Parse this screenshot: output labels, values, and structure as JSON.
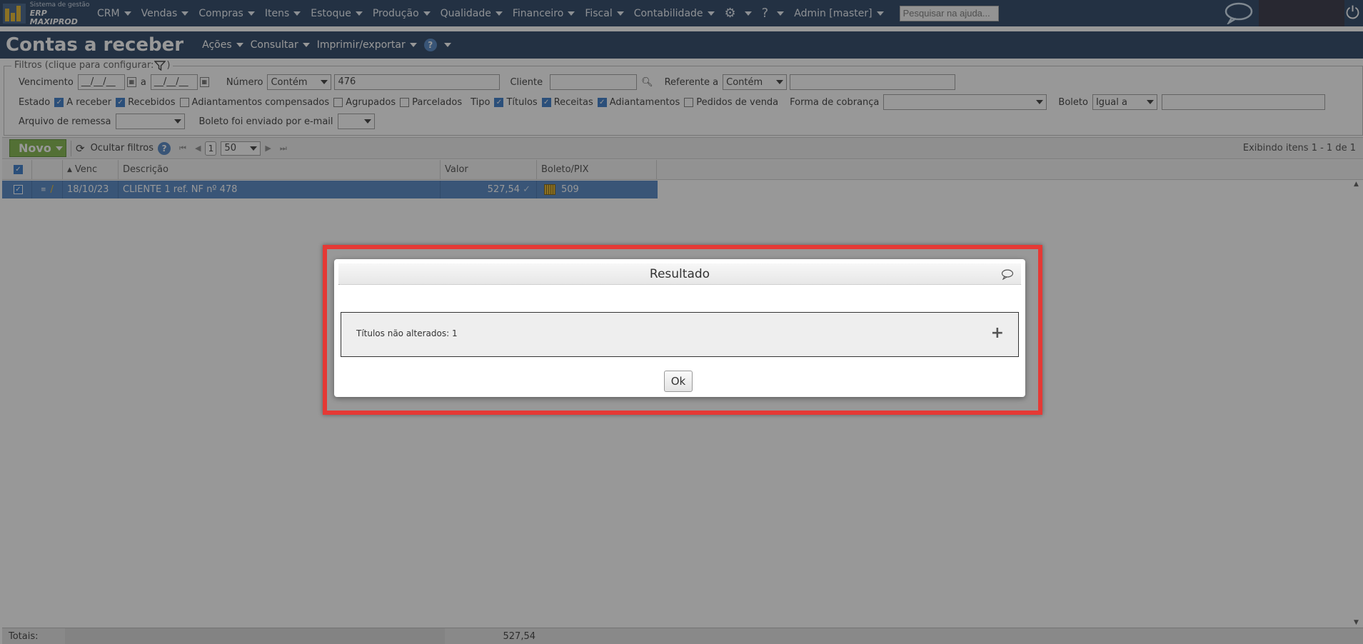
{
  "logo": {
    "line1": "Sistema de gestão",
    "line2": "ERP MAXIPROD"
  },
  "menu": [
    "CRM",
    "Vendas",
    "Compras",
    "Itens",
    "Estoque",
    "Produção",
    "Qualidade",
    "Financeiro",
    "Fiscal",
    "Contabilidade"
  ],
  "user": "Admin [master]",
  "help_search": {
    "placeholder": "Pesquisar na ajuda..."
  },
  "page": {
    "title": "Contas a receber",
    "actions": "Ações",
    "consult": "Consultar",
    "print_export": "Imprimir/exportar",
    "help": "?"
  },
  "filters": {
    "legend": "Filtros (clique para configurar:",
    "legend_close": ")",
    "vencimento_label": "Vencimento",
    "date_from": "__/__/__",
    "a_label": "a",
    "date_to": "__/__/__",
    "numero_label": "Número",
    "numero_op": "Contém",
    "numero_value": "476",
    "cliente_label": "Cliente",
    "cliente_value": "",
    "referente_label": "Referente a",
    "referente_op": "Contém",
    "referente_value": "",
    "estado_label": "Estado",
    "estado": [
      {
        "label": "A receber",
        "checked": true
      },
      {
        "label": "Recebidos",
        "checked": true
      },
      {
        "label": "Adiantamentos compensados",
        "checked": false
      },
      {
        "label": "Agrupados",
        "checked": false
      },
      {
        "label": "Parcelados",
        "checked": false
      }
    ],
    "tipo_label": "Tipo",
    "tipo": [
      {
        "label": "Títulos",
        "checked": true
      },
      {
        "label": "Receitas",
        "checked": true
      },
      {
        "label": "Adiantamentos",
        "checked": true
      },
      {
        "label": "Pedidos de venda",
        "checked": false
      }
    ],
    "forma_label": "Forma de cobrança",
    "forma_value": "",
    "boleto_label": "Boleto",
    "boleto_op": "Igual a",
    "boleto_value": "",
    "remessa_label": "Arquivo de remessa",
    "remessa_value": "",
    "email_label": "Boleto foi enviado por e-mail",
    "email_value": ""
  },
  "toolbar": {
    "novo": "Novo",
    "hide_filters": "Ocultar filtros",
    "help": "?",
    "page": "1",
    "page_size": "50",
    "showing": "Exibindo itens 1 - 1 de 1"
  },
  "grid": {
    "headers": {
      "venc": "Venc",
      "descricao": "Descrição",
      "valor": "Valor",
      "boleto": "Boleto/PIX"
    },
    "rows": [
      {
        "venc": "18/10/23",
        "descricao": "CLIENTE 1 ref. NF nº 478",
        "valor": "527,54",
        "boleto": "509"
      }
    ],
    "totals_label": "Totais:",
    "totals_value": "527,54"
  },
  "modal": {
    "title": "Resultado",
    "message": "Títulos não alterados: 1",
    "ok": "Ok"
  }
}
